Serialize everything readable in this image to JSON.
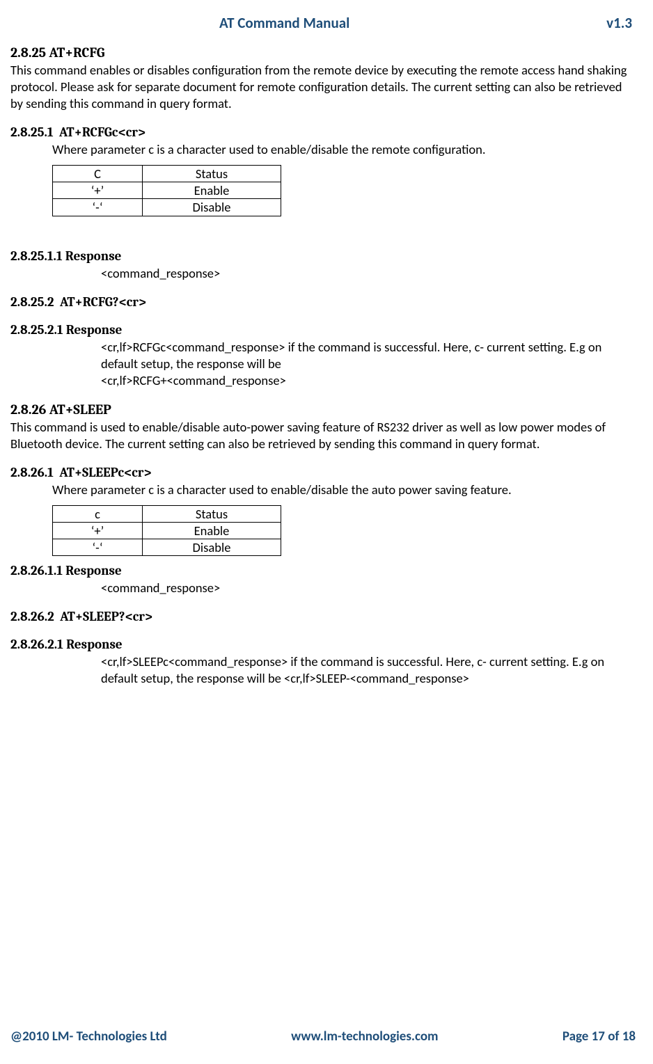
{
  "header": {
    "title": "AT Command Manual",
    "version": "v1.3"
  },
  "s2825": {
    "num": "2.8.25",
    "title": "AT+RCFG",
    "desc": "This command enables or disables configuration from the remote device by executing the remote access hand shaking protocol. Please ask for separate document for remote configuration details. The current setting can also be retrieved by sending this command in query format."
  },
  "s28251": {
    "num": "2.8.25.1",
    "title": "AT+RCFGc<cr>",
    "desc": "Where parameter c is a character used to enable/disable the remote configuration.",
    "table": {
      "h1": "C",
      "h2": "Status",
      "r1c1": "‘+’",
      "r1c2": "Enable",
      "r2c1": "‘-‘",
      "r2c2": "Disable"
    }
  },
  "s282511": {
    "num": "2.8.25.1.1",
    "title": "Response",
    "body": "<command_response>"
  },
  "s28252": {
    "num": "2.8.25.2",
    "title": "AT+RCFG?<cr>"
  },
  "s282521": {
    "num": "2.8.25.2.1",
    "title": "Response",
    "line1": "<cr,lf>RCFGc<command_response> if the command is successful. Here, c- current setting. E.g on default setup, the response will be",
    "line2": "<cr,lf>RCFG+<command_response>"
  },
  "s2826": {
    "num": "2.8.26",
    "title": "AT+SLEEP",
    "desc": "This command is used to enable/disable auto-power saving feature of RS232 driver as well as low power modes of Bluetooth device. The current setting can also be retrieved by sending this command in query format."
  },
  "s28261": {
    "num": "2.8.26.1",
    "title": "AT+SLEEPc<cr>",
    "desc": "Where parameter c is a character used to enable/disable the auto power saving feature.",
    "table": {
      "h1": "c",
      "h2": "Status",
      "r1c1": "‘+’",
      "r1c2": "Enable",
      "r2c1": "‘-‘",
      "r2c2": "Disable"
    }
  },
  "s282611": {
    "num": "2.8.26.1.1",
    "title": "Response",
    "body": "<command_response>"
  },
  "s28262": {
    "num": "2.8.26.2",
    "title": "AT+SLEEP?<cr>"
  },
  "s282621": {
    "num": "2.8.26.2.1",
    "title": "Response",
    "line1": "<cr,lf>SLEEPc<command_response> if the command is successful. Here, c- current setting. E.g on default setup, the response will be <cr,lf>SLEEP-<command_response>"
  },
  "footer": {
    "left": "@2010 LM- Technologies Ltd",
    "center": "www.lm-technologies.com",
    "right": "Page 17 of 18"
  }
}
